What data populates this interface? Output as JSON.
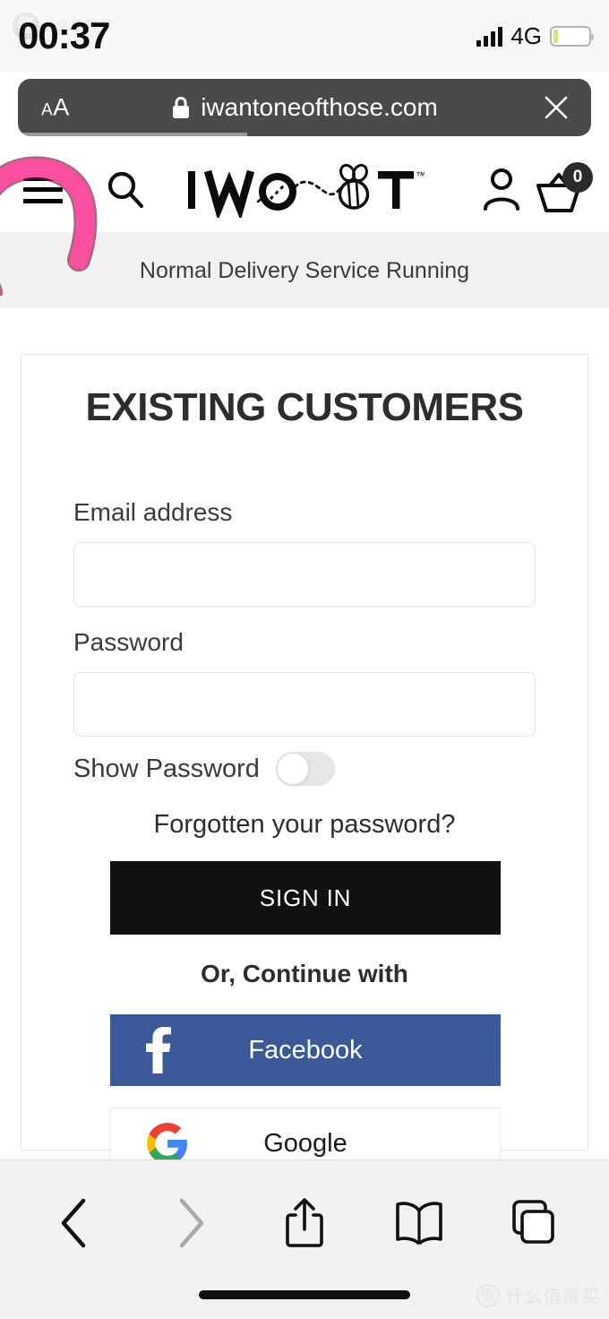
{
  "status_bar": {
    "time": "00:37",
    "network": "4G",
    "signal_bars": 4,
    "battery_level_percent": 8,
    "watermark_badge": "值",
    "watermark_text": "什么值得买"
  },
  "browser": {
    "text_size_small": "A",
    "text_size_large": "A",
    "lock_icon": "lock-icon",
    "url": "iwantoneofthose.com",
    "close_label": "×",
    "progress_percent": 40,
    "toolbar": {
      "back": "back-icon",
      "forward": "forward-icon",
      "share": "share-icon",
      "bookmarks": "bookmarks-icon",
      "tabs": "tabs-icon"
    },
    "watermark_badge": "值",
    "watermark_text": "什么值得买"
  },
  "site_header": {
    "menu_label": "menu-icon",
    "search_label": "search-icon",
    "logo_text": "IWOOT",
    "logo_trademark": "™",
    "account_label": "account-icon",
    "basket_label": "basket-icon",
    "basket_count": "0"
  },
  "delivery_banner": {
    "message": "Normal Delivery Service Running"
  },
  "login_card": {
    "title": "EXISTING CUSTOMERS",
    "email": {
      "label": "Email address",
      "value": "",
      "placeholder": ""
    },
    "password": {
      "label": "Password",
      "value": "",
      "placeholder": ""
    },
    "show_password": {
      "label": "Show Password",
      "state": "off"
    },
    "forgot_link": "Forgotten your password?",
    "submit_label": "SIGN IN",
    "divider_label": "Or, Continue with",
    "social": [
      {
        "name": "Facebook",
        "color": "#3b5998",
        "text_color": "#ffffff"
      },
      {
        "name": "Google",
        "color": "#ffffff",
        "text_color": "#1a1a1a"
      }
    ]
  },
  "annotation": {
    "type": "hand-drawn-circle",
    "color": "#f94f9e",
    "target": "menu-icon"
  },
  "colors": {
    "facebook_blue": "#3b5998",
    "signin_black": "#111111",
    "banner_gray": "#f1f1f1",
    "annotation_pink": "#f94f9e"
  }
}
